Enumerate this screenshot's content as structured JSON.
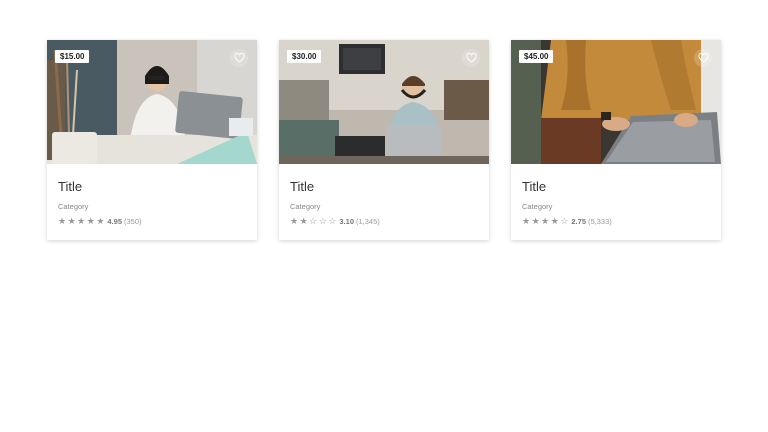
{
  "cards": [
    {
      "price": "$15.00",
      "title": "Title",
      "category": "Category",
      "rating": 4.95,
      "rating_text": "4.95",
      "stars": [
        "★",
        "★",
        "★",
        "★",
        "★"
      ],
      "reviews": "(350)",
      "image": "woman-with-phone-and-laptop"
    },
    {
      "price": "$30.00",
      "title": "Title",
      "category": "Category",
      "rating": 3.1,
      "rating_text": "3.10",
      "stars": [
        "★",
        "★",
        "☆",
        "☆",
        "☆"
      ],
      "reviews": "(1,345)",
      "image": "man-with-headphones-in-cafe"
    },
    {
      "price": "$45.00",
      "title": "Title",
      "category": "Category",
      "rating": 2.75,
      "rating_text": "2.75",
      "stars": [
        "★",
        "★",
        "★",
        "★",
        "☆"
      ],
      "reviews": "(5,333)",
      "image": "person-typing-on-laptop"
    }
  ]
}
